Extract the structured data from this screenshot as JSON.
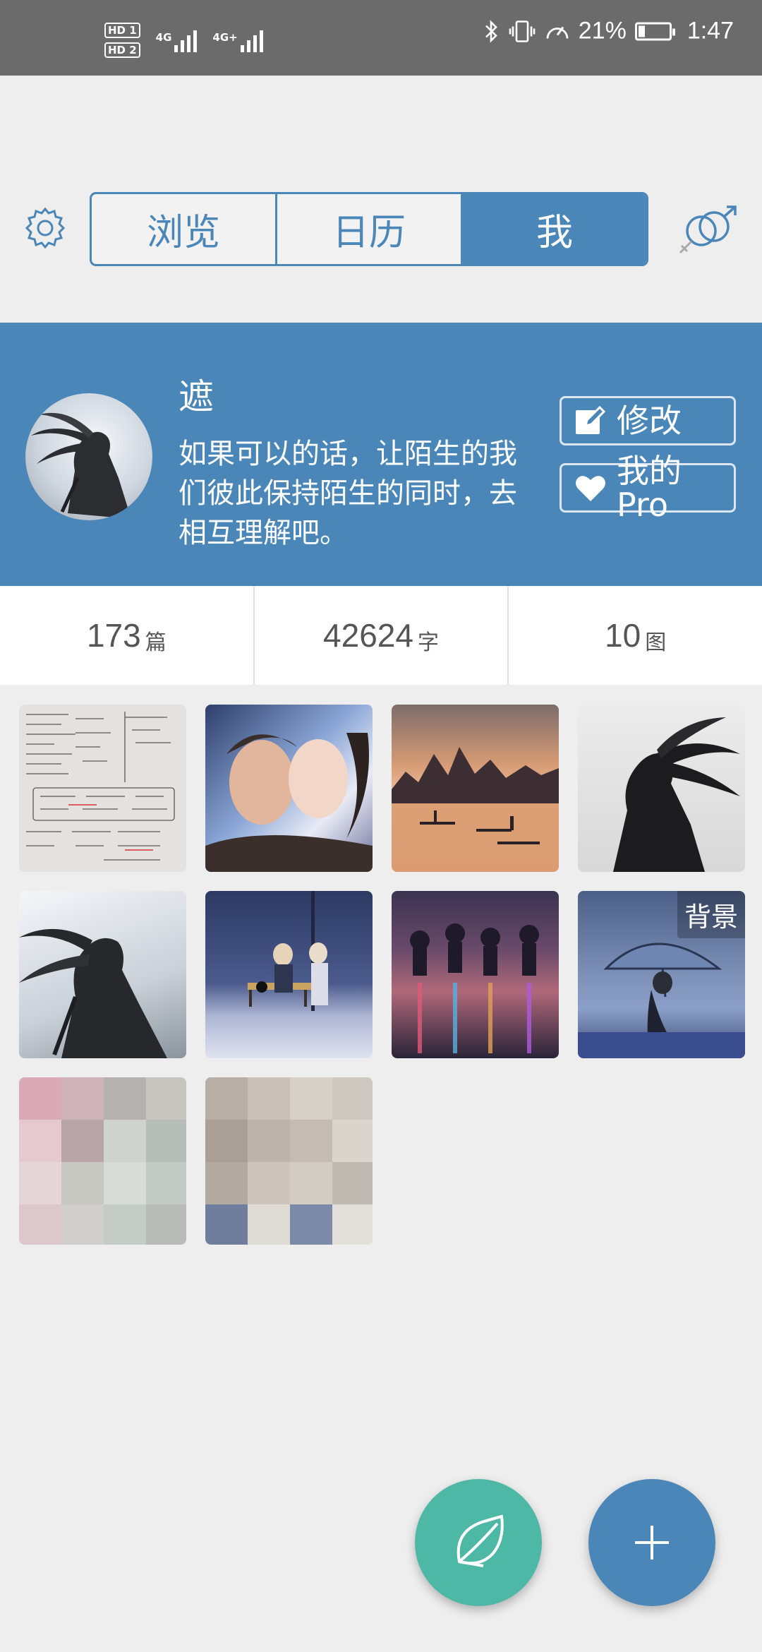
{
  "status_bar": {
    "hd1": "HD 1",
    "hd2": "HD 2",
    "net1": "4G",
    "net2": "4G+",
    "battery_percent": "21%",
    "time": "1:47"
  },
  "nav": {
    "tabs": [
      {
        "label": "浏览",
        "active": false
      },
      {
        "label": "日历",
        "active": false
      },
      {
        "label": "我",
        "active": true
      }
    ],
    "settings_icon": "gear-icon",
    "gender_icon": "gender-icon"
  },
  "profile": {
    "name": "遮",
    "bio": "如果可以的话，让陌生的我们彼此保持陌生的同时，去相互理解吧。",
    "edit_label": "修改",
    "pro_label": "我的\nPro"
  },
  "stats": [
    {
      "value": "173",
      "unit": "篇"
    },
    {
      "value": "42624",
      "unit": "字"
    },
    {
      "value": "10",
      "unit": "图"
    }
  ],
  "gallery": {
    "background_tag": "背景"
  },
  "colors": {
    "primary": "#4a86b7",
    "accent": "#4db8a5",
    "status_bar": "#6b6b6b",
    "background": "#eeeeee"
  }
}
